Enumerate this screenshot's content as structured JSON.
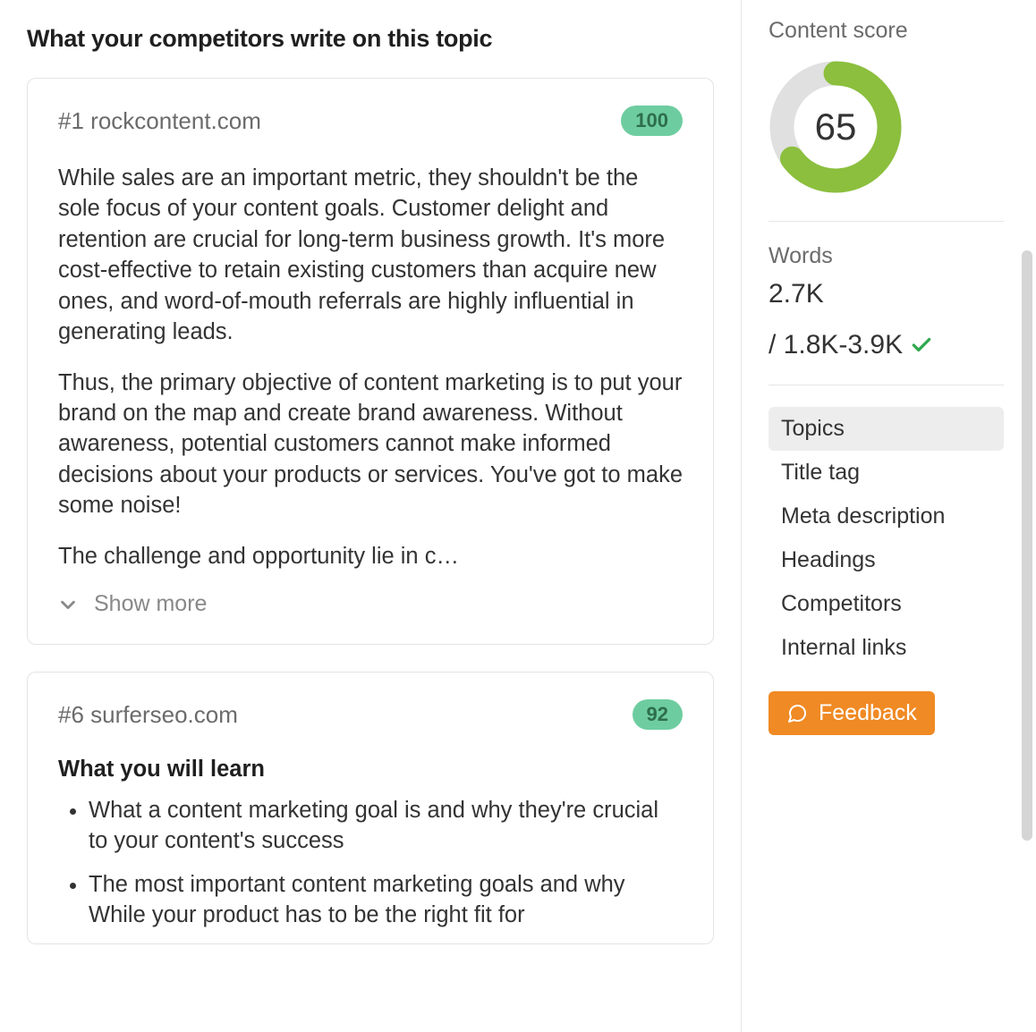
{
  "section_title": "What your competitors write on this topic",
  "competitors": [
    {
      "rank": "#1",
      "domain": "rockcontent.com",
      "score": "100",
      "paragraphs": [
        "While sales are an important metric, they shouldn't be the sole focus of your content goals. Customer delight and retention are crucial for long-term business growth. It's more cost-effective to retain existing customers than acquire new ones, and word-of-mouth referrals are highly influential in generating leads.",
        "Thus, the primary objective of content marketing is to put your brand on the map and create brand awareness. Without awareness, potential customers cannot make informed decisions about your products or services. You've got to make some noise!",
        "The challenge and opportunity lie in c…"
      ],
      "show_more_label": "Show more"
    },
    {
      "rank": "#6",
      "domain": "surferseo.com",
      "score": "92",
      "subhead": "What you will learn",
      "bullets": [
        "What a content marketing goal is and why they're crucial to your content's success",
        "The most important content marketing goals and why While your product has to be the right fit for"
      ]
    }
  ],
  "sidebar": {
    "score_label": "Content score",
    "score_value": "65",
    "score_pct": 65,
    "words_label": "Words",
    "words_value": "2.7K",
    "words_range": "/ 1.8K-3.9K",
    "nav": [
      "Topics",
      "Title tag",
      "Meta description",
      "Headings",
      "Competitors",
      "Internal links"
    ],
    "active_nav_index": 0,
    "feedback_label": "Feedback"
  }
}
